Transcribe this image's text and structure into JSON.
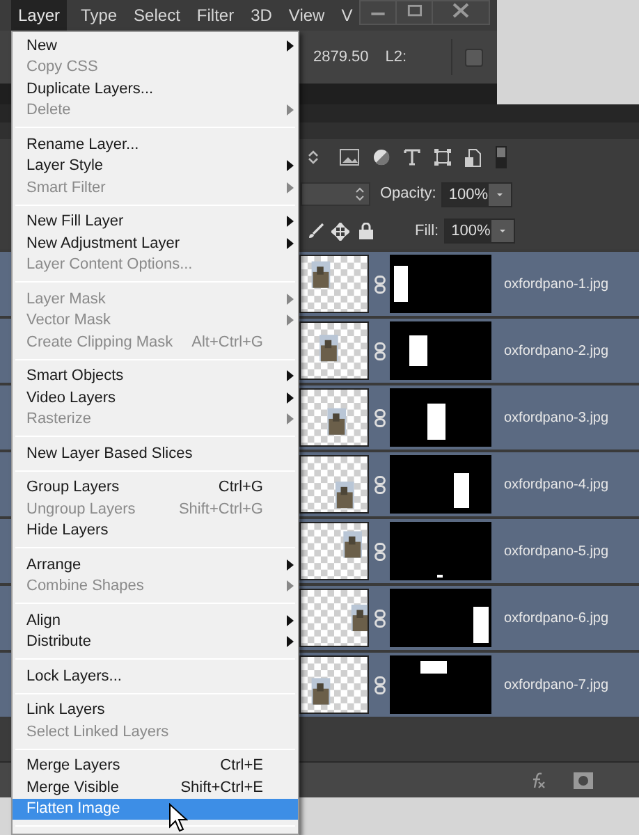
{
  "menu_bar": [
    {
      "label": "Layer",
      "selected": true
    },
    {
      "label": "Type",
      "selected": false
    },
    {
      "label": "Select",
      "selected": false
    },
    {
      "label": "Filter",
      "selected": false
    },
    {
      "label": "3D",
      "selected": false
    },
    {
      "label": "View",
      "selected": false
    },
    {
      "label": "V",
      "selected": false
    }
  ],
  "options_bar": {
    "value": "2879.50",
    "label": "L2:",
    "checked": false
  },
  "layers_panel": {
    "opacity_label": "Opacity:",
    "opacity": "100%",
    "fill_label": "Fill:",
    "fill": "100%",
    "layers": [
      {
        "name": "oxfordpano-1.jpg",
        "selected": true
      },
      {
        "name": "oxfordpano-2.jpg",
        "selected": true
      },
      {
        "name": "oxfordpano-3.jpg",
        "selected": true
      },
      {
        "name": "oxfordpano-4.jpg",
        "selected": true
      },
      {
        "name": "oxfordpano-5.jpg",
        "selected": true
      },
      {
        "name": "oxfordpano-6.jpg",
        "selected": true
      },
      {
        "name": "oxfordpano-7.jpg",
        "selected": true
      }
    ]
  },
  "menu": {
    "sections": [
      [
        {
          "label": "New",
          "disabled": false,
          "submenu": true,
          "selected": false
        },
        {
          "label": "Copy CSS",
          "disabled": true,
          "submenu": false,
          "selected": false
        },
        {
          "label": "Duplicate Layers...",
          "disabled": false,
          "submenu": false,
          "selected": false
        },
        {
          "label": "Delete",
          "disabled": true,
          "submenu": true,
          "selected": false
        }
      ],
      [
        {
          "label": "Rename Layer...",
          "disabled": false,
          "submenu": false,
          "selected": false
        },
        {
          "label": "Layer Style",
          "disabled": false,
          "submenu": true,
          "selected": false
        },
        {
          "label": "Smart Filter",
          "disabled": true,
          "submenu": true,
          "selected": false
        }
      ],
      [
        {
          "label": "New Fill Layer",
          "disabled": false,
          "submenu": true,
          "selected": false
        },
        {
          "label": "New Adjustment Layer",
          "disabled": false,
          "submenu": true,
          "selected": false
        },
        {
          "label": "Layer Content Options...",
          "disabled": true,
          "submenu": false,
          "selected": false
        }
      ],
      [
        {
          "label": "Layer Mask",
          "disabled": true,
          "submenu": true,
          "selected": false
        },
        {
          "label": "Vector Mask",
          "disabled": true,
          "submenu": true,
          "selected": false
        },
        {
          "label": "Create Clipping Mask",
          "shortcut": "Alt+Ctrl+G",
          "disabled": true,
          "submenu": false,
          "selected": false
        }
      ],
      [
        {
          "label": "Smart Objects",
          "disabled": false,
          "submenu": true,
          "selected": false
        },
        {
          "label": "Video Layers",
          "disabled": false,
          "submenu": true,
          "selected": false
        },
        {
          "label": "Rasterize",
          "disabled": true,
          "submenu": true,
          "selected": false
        }
      ],
      [
        {
          "label": "New Layer Based Slices",
          "disabled": false,
          "submenu": false,
          "selected": false
        }
      ],
      [
        {
          "label": "Group Layers",
          "shortcut": "Ctrl+G",
          "disabled": false,
          "submenu": false,
          "selected": false
        },
        {
          "label": "Ungroup Layers",
          "shortcut": "Shift+Ctrl+G",
          "disabled": true,
          "submenu": false,
          "selected": false
        },
        {
          "label": "Hide Layers",
          "disabled": false,
          "submenu": false,
          "selected": false
        }
      ],
      [
        {
          "label": "Arrange",
          "disabled": false,
          "submenu": true,
          "selected": false
        },
        {
          "label": "Combine Shapes",
          "disabled": true,
          "submenu": true,
          "selected": false
        }
      ],
      [
        {
          "label": "Align",
          "disabled": false,
          "submenu": true,
          "selected": false
        },
        {
          "label": "Distribute",
          "disabled": false,
          "submenu": true,
          "selected": false
        }
      ],
      [
        {
          "label": "Lock Layers...",
          "disabled": false,
          "submenu": false,
          "selected": false
        }
      ],
      [
        {
          "label": "Link Layers",
          "disabled": false,
          "submenu": false,
          "selected": false
        },
        {
          "label": "Select Linked Layers",
          "disabled": true,
          "submenu": false,
          "selected": false
        }
      ],
      [
        {
          "label": "Merge Layers",
          "shortcut": "Ctrl+E",
          "disabled": false,
          "submenu": false,
          "selected": false
        },
        {
          "label": "Merge Visible",
          "shortcut": "Shift+Ctrl+E",
          "disabled": false,
          "submenu": false,
          "selected": false
        },
        {
          "label": "Flatten Image",
          "disabled": false,
          "submenu": false,
          "selected": true
        }
      ]
    ]
  }
}
